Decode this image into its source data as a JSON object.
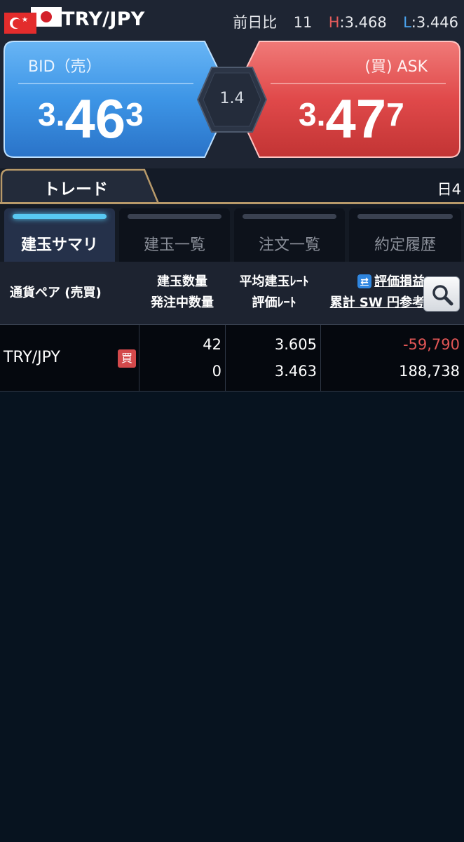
{
  "header": {
    "pair": "TRY/JPY",
    "change_label": "前日比",
    "change_value": "11",
    "high_label": "H",
    "high_value": "3.468",
    "low_label": "L",
    "low_value": "3.446",
    "flags": [
      "turkey-flag",
      "japan-flag"
    ]
  },
  "quote": {
    "bid_label": "BID（売）",
    "bid_price": {
      "prefix": "3.",
      "big": "46",
      "pip": "3"
    },
    "ask_label": "(買) ASK",
    "ask_price": {
      "prefix": "3.",
      "big": "47",
      "pip": "7"
    },
    "spread": "1.4"
  },
  "trade": {
    "tab_label": "トレード",
    "day_label": "日4"
  },
  "subtabs": [
    {
      "label": "建玉サマリ",
      "active": true
    },
    {
      "label": "建玉一覧",
      "active": false
    },
    {
      "label": "注文一覧",
      "active": false
    },
    {
      "label": "約定履歴",
      "active": false
    }
  ],
  "table": {
    "headers": {
      "pair": "通貨ペア (売買)",
      "qty_line1": "建玉数量",
      "qty_line2": "発注中数量",
      "rate_line1": "平均建玉ﾚｰﾄ",
      "rate_line2": "評価ﾚｰﾄ",
      "pl_line1": "評価損益",
      "pl_line2": "累計 SW 円参考"
    },
    "rows": [
      {
        "pair": "TRY/JPY",
        "side": "買",
        "qty": "42",
        "pending_qty": "0",
        "avg_rate": "3.605",
        "eval_rate": "3.463",
        "pl": "-59,790",
        "swap": "188,738"
      }
    ]
  },
  "colors": {
    "bid_blue": "#3d95e6",
    "ask_red": "#e0494a",
    "active_tab_glow": "#58c8f2",
    "negative": "#e35656",
    "gold_border": "#b89a6a"
  },
  "icons": {
    "swap": "swap-arrows-icon",
    "search": "search-icon"
  }
}
